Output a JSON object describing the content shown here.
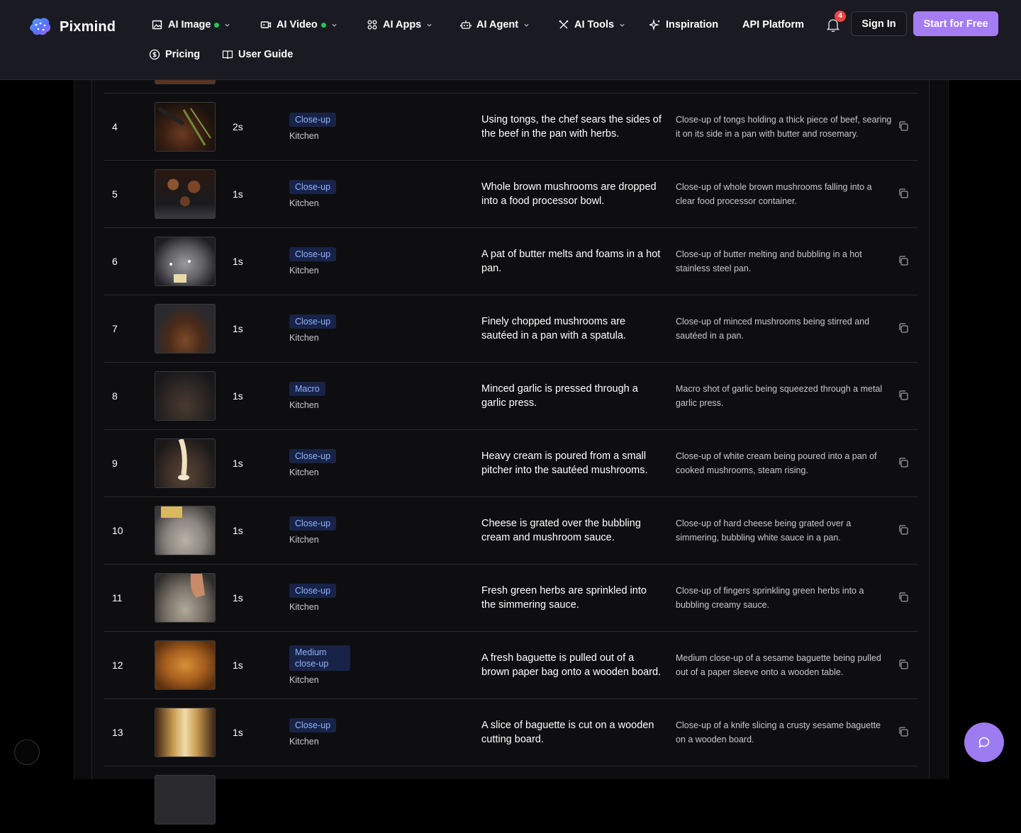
{
  "brand": {
    "name": "Pixmind"
  },
  "nav": {
    "ai_image": "AI Image",
    "ai_video": "AI Video",
    "ai_apps": "AI Apps",
    "ai_agent": "AI Agent",
    "ai_tools": "AI Tools",
    "inspiration": "Inspiration",
    "api_platform": "API Platform",
    "pricing": "Pricing",
    "user_guide": "User Guide"
  },
  "notifications": {
    "count": "4"
  },
  "auth": {
    "sign_in": "Sign In",
    "start_free": "Start for Free"
  },
  "colors": {
    "accent": "#a57cf4",
    "tag_bg": "#182347",
    "tag_text": "#8fb3ff",
    "live_dot": "#22c55e",
    "badge": "#ef4444"
  },
  "rows": [
    {
      "num": "4",
      "duration": "2s",
      "shot": "Close-up",
      "location": "Kitchen",
      "description": "Using tongs, the chef sears the sides of the beef in the pan with herbs.",
      "prompt": "Close-up of tongs holding a thick piece of beef, searing it on its side in a pan with butter and rosemary."
    },
    {
      "num": "5",
      "duration": "1s",
      "shot": "Close-up",
      "location": "Kitchen",
      "description": "Whole brown mushrooms are dropped into a food processor bowl.",
      "prompt": "Close-up of whole brown mushrooms falling into a clear food processor container."
    },
    {
      "num": "6",
      "duration": "1s",
      "shot": "Close-up",
      "location": "Kitchen",
      "description": "A pat of butter melts and foams in a hot pan.",
      "prompt": "Close-up of butter melting and bubbling in a hot stainless steel pan."
    },
    {
      "num": "7",
      "duration": "1s",
      "shot": "Close-up",
      "location": "Kitchen",
      "description": "Finely chopped mushrooms are sautéed in a pan with a spatula.",
      "prompt": "Close-up of minced mushrooms being stirred and sautéed in a pan."
    },
    {
      "num": "8",
      "duration": "1s",
      "shot": "Macro",
      "location": "Kitchen",
      "description": "Minced garlic is pressed through a garlic press.",
      "prompt": "Macro shot of garlic being squeezed through a metal garlic press."
    },
    {
      "num": "9",
      "duration": "1s",
      "shot": "Close-up",
      "location": "Kitchen",
      "description": "Heavy cream is poured from a small pitcher into the sautéed mushrooms.",
      "prompt": "Close-up of white cream being poured into a pan of cooked mushrooms, steam rising."
    },
    {
      "num": "10",
      "duration": "1s",
      "shot": "Close-up",
      "location": "Kitchen",
      "description": "Cheese is grated over the bubbling cream and mushroom sauce.",
      "prompt": "Close-up of hard cheese being grated over a simmering, bubbling white sauce in a pan."
    },
    {
      "num": "11",
      "duration": "1s",
      "shot": "Close-up",
      "location": "Kitchen",
      "description": "Fresh green herbs are sprinkled into the simmering sauce.",
      "prompt": "Close-up of fingers sprinkling green herbs into a bubbling creamy sauce."
    },
    {
      "num": "12",
      "duration": "1s",
      "shot": "Medium close-up",
      "location": "Kitchen",
      "description": "A fresh baguette is pulled out of a brown paper bag onto a wooden board.",
      "prompt": "Medium close-up of a sesame baguette being pulled out of a paper sleeve onto a wooden table."
    },
    {
      "num": "13",
      "duration": "1s",
      "shot": "Close-up",
      "location": "Kitchen",
      "description": "A slice of baguette is cut on a wooden cutting board.",
      "prompt": "Close-up of a knife slicing a crusty sesame baguette on a wooden board."
    }
  ]
}
